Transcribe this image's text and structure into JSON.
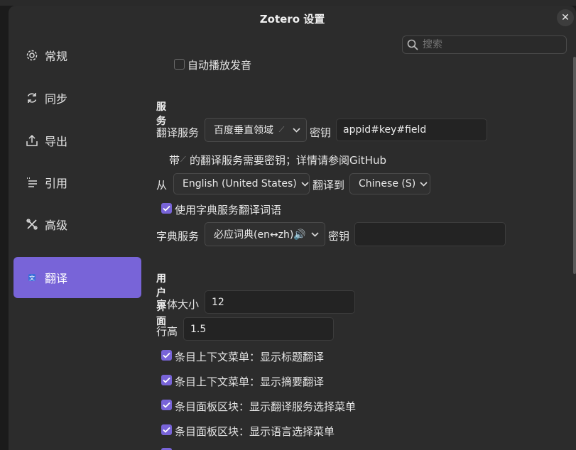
{
  "window": {
    "title": "Zotero 设置",
    "close_glyph": "✕"
  },
  "search": {
    "placeholder": "搜索"
  },
  "sidebar": {
    "items": [
      {
        "label": "常规",
        "icon": "gear-icon"
      },
      {
        "label": "同步",
        "icon": "sync-icon"
      },
      {
        "label": "导出",
        "icon": "export-icon"
      },
      {
        "label": "引用",
        "icon": "cite-icon"
      },
      {
        "label": "高级",
        "icon": "tools-icon"
      },
      {
        "label": "翻译",
        "icon": "translate-icon",
        "active": true
      }
    ]
  },
  "content": {
    "autoplay_label": "自动播放发音",
    "services": {
      "title": "服务",
      "translate_service_label": "翻译服务",
      "translate_service_value": "百度垂直领域",
      "key_label": "密钥",
      "key_value": "appid#key#field",
      "hint_prefix": "带",
      "hint_text": "的翻译服务需要密钥；详情请参阅GitHub",
      "from_label": "从",
      "from_value": "English (United States)",
      "to_label": "翻译到",
      "to_value": "Chinese (S)",
      "use_dict_label": "使用字典服务翻译词语",
      "dict_service_label": "字典服务",
      "dict_service_value": "必应词典(en↔zh)🔊",
      "dict_key_label": "密钥",
      "dict_key_value": ""
    },
    "ui": {
      "title": "用户界面",
      "font_size_label": "字体大小",
      "font_size_value": "12",
      "line_height_label": "行高",
      "line_height_value": "1.5",
      "options": [
        {
          "label": "条目上下文菜单：显示标题翻译",
          "checked": true
        },
        {
          "label": "条目上下文菜单：显示摘要翻译",
          "checked": true
        },
        {
          "label": "条目面板区块：显示翻译服务选择菜单",
          "checked": true
        },
        {
          "label": "条目面板区块：显示语言选择菜单",
          "checked": true
        }
      ]
    }
  },
  "colors": {
    "accent": "#7864d8",
    "background": "#2c2c2c"
  }
}
